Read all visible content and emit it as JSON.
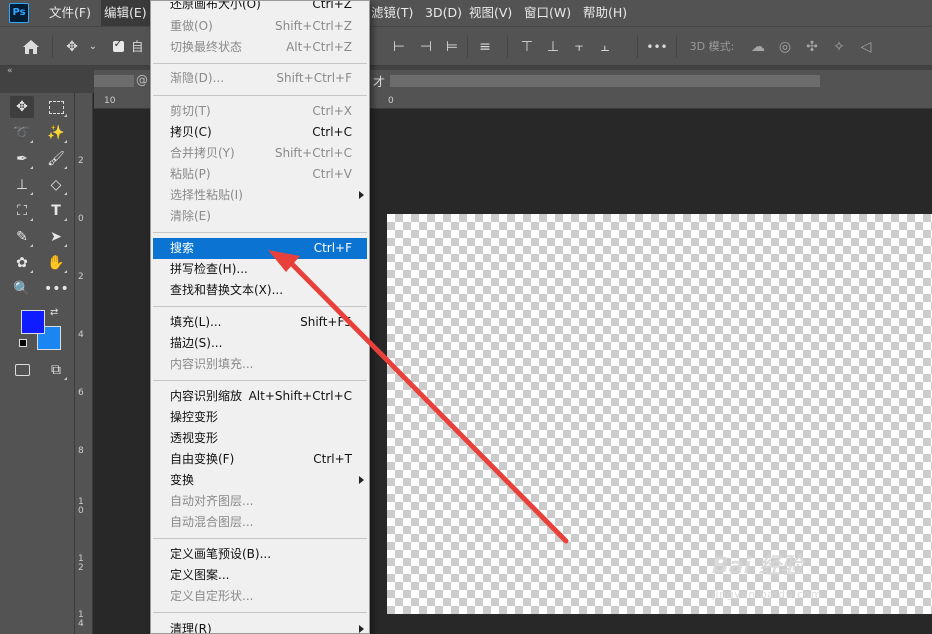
{
  "app": {
    "logo_text": "Ps"
  },
  "menubar": {
    "items": [
      {
        "label": "文件(F)"
      },
      {
        "label": "编辑(E)"
      },
      {
        "label": "滤镜(T)"
      },
      {
        "label": "3D(D)"
      },
      {
        "label": "视图(V)"
      },
      {
        "label": "窗口(W)"
      },
      {
        "label": "帮助(H)"
      }
    ]
  },
  "optionsbar": {
    "auto_select_label": "自动",
    "auto_select_checked": true,
    "more_label": "•••",
    "mode_3d_label": "3D 模式:"
  },
  "tabstrip": {
    "collapse_label": "«",
    "at_sign": "@",
    "tab_char": "才"
  },
  "rulers": {
    "horizontal_ticks": [
      "10",
      "0"
    ],
    "vertical_ticks": [
      "2",
      "0",
      "2",
      "4",
      "6",
      "8",
      "1\n0",
      "1\n2",
      "1\n4"
    ]
  },
  "colors": {
    "foreground": "#0f1cff",
    "background": "#1b86f2",
    "highlight": "#0b74d3",
    "arrow": "#e8403a"
  },
  "edit_menu": {
    "items": [
      {
        "label": "还原画布大小(O)",
        "shortcut": "Ctrl+Z",
        "disabled": false
      },
      {
        "label": "重做(O)",
        "shortcut": "Shift+Ctrl+Z",
        "disabled": true
      },
      {
        "label": "切换最终状态",
        "shortcut": "Alt+Ctrl+Z",
        "disabled": true
      },
      {
        "label": "渐隐(D)...",
        "shortcut": "Shift+Ctrl+F",
        "disabled": true
      },
      {
        "label": "剪切(T)",
        "shortcut": "Ctrl+X",
        "disabled": true
      },
      {
        "label": "拷贝(C)",
        "shortcut": "Ctrl+C",
        "disabled": false
      },
      {
        "label": "合并拷贝(Y)",
        "shortcut": "Shift+Ctrl+C",
        "disabled": true
      },
      {
        "label": "粘贴(P)",
        "shortcut": "Ctrl+V",
        "disabled": true
      },
      {
        "label": "选择性粘贴(I)",
        "shortcut": "",
        "disabled": true
      },
      {
        "label": "清除(E)",
        "shortcut": "",
        "disabled": true
      },
      {
        "label": "搜索",
        "shortcut": "Ctrl+F",
        "disabled": false
      },
      {
        "label": "拼写检查(H)...",
        "shortcut": "",
        "disabled": false
      },
      {
        "label": "查找和替换文本(X)...",
        "shortcut": "",
        "disabled": false
      },
      {
        "label": "填充(L)...",
        "shortcut": "Shift+F5",
        "disabled": false
      },
      {
        "label": "描边(S)...",
        "shortcut": "",
        "disabled": false
      },
      {
        "label": "内容识别填充...",
        "shortcut": "",
        "disabled": true
      },
      {
        "label": "内容识别缩放",
        "shortcut": "Alt+Shift+Ctrl+C",
        "disabled": false
      },
      {
        "label": "操控变形",
        "shortcut": "",
        "disabled": false
      },
      {
        "label": "透视变形",
        "shortcut": "",
        "disabled": false
      },
      {
        "label": "自由变换(F)",
        "shortcut": "Ctrl+T",
        "disabled": false
      },
      {
        "label": "变换",
        "shortcut": "",
        "disabled": false
      },
      {
        "label": "自动对齐图层...",
        "shortcut": "",
        "disabled": true
      },
      {
        "label": "自动混合图层...",
        "shortcut": "",
        "disabled": true
      },
      {
        "label": "定义画笔预设(B)...",
        "shortcut": "",
        "disabled": false
      },
      {
        "label": "定义图案...",
        "shortcut": "",
        "disabled": false
      },
      {
        "label": "定义自定形状...",
        "shortcut": "",
        "disabled": true
      },
      {
        "label": "清理(R)",
        "shortcut": "",
        "disabled": false
      }
    ]
  },
  "watermark": {
    "brand": "Bai 经验",
    "url": "jingyan.baidu.com"
  }
}
